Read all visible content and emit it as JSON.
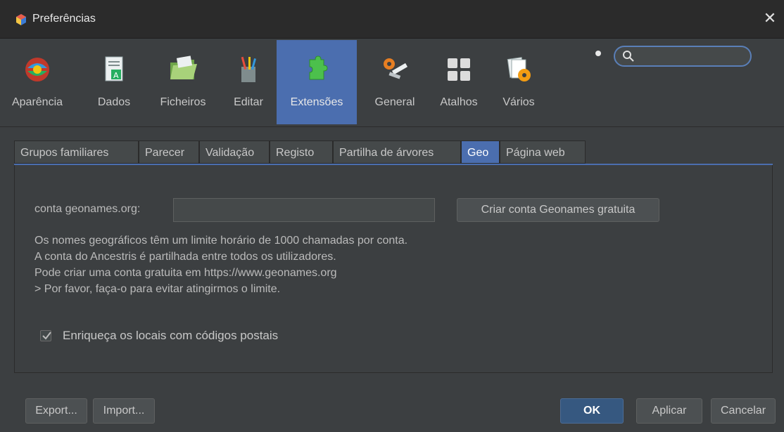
{
  "window": {
    "title": "Preferências",
    "close_label": "✕"
  },
  "toolbar": {
    "items": [
      {
        "label": "Aparência",
        "icon": "appearance-icon"
      },
      {
        "label": "Dados",
        "icon": "data-icon"
      },
      {
        "label": "Ficheiros",
        "icon": "folder-icon"
      },
      {
        "label": "Editar",
        "icon": "edit-icon"
      },
      {
        "label": "Extensões",
        "icon": "puzzle-icon",
        "active": true
      },
      {
        "label": "General",
        "icon": "tools-icon"
      },
      {
        "label": "Atalhos",
        "icon": "keyboard-icon"
      },
      {
        "label": "Vários",
        "icon": "misc-icon"
      }
    ],
    "search_value": "",
    "accent_color": "#4b6eaf"
  },
  "tabs": [
    {
      "label": "Grupos familiares"
    },
    {
      "label": "Parecer"
    },
    {
      "label": "Validação"
    },
    {
      "label": "Registo"
    },
    {
      "label": "Partilha de árvores"
    },
    {
      "label": "Geo",
      "active": true
    },
    {
      "label": "Página web"
    }
  ],
  "geo": {
    "account_label": "conta geonames.org:",
    "account_value": "",
    "create_button": "Criar conta Geonames gratuita",
    "info_lines": [
      "Os nomes geográficos têm um limite horário de 1000 chamadas por conta.",
      "A conta do Ancestris é partilhada entre todos os utilizadores.",
      "Pode criar uma conta gratuita em https://www.geonames.org",
      "> Por favor, faça-o para evitar atingirmos o limite."
    ],
    "enrich_label": "Enriqueça os locais com códigos postais",
    "enrich_checked": true
  },
  "footer": {
    "export": "Export...",
    "import": "Import...",
    "ok": "OK",
    "apply": "Aplicar",
    "cancel": "Cancelar"
  }
}
